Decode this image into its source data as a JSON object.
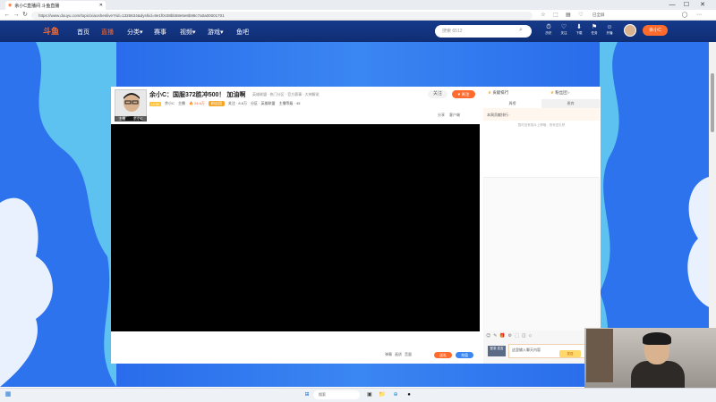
{
  "browser": {
    "tab_title": "余小C直播间 斗鱼直播",
    "url": "https://www.douyu.com/topic/xiaoshenlive?rid=1326634&dyshid=8e1f0c08bb58e5e8b98c7a0a00001701",
    "buttons": {
      "back": "←",
      "forward": "→",
      "refresh": "↻"
    },
    "window": {
      "minimize": "—",
      "maximize": "☐",
      "close": "✕"
    },
    "toolbar_icons": [
      "star-icon",
      "extensions-icon",
      "profile-icon",
      "menu-icon"
    ],
    "right_text": "已全屏"
  },
  "header": {
    "logo": "斗鱼",
    "nav": [
      "首页",
      "直播",
      "分类▾",
      "赛事",
      "视频▾",
      "游戏▾",
      "鱼吧"
    ],
    "active_nav": "直播",
    "search_placeholder": "搜索 6512",
    "icons": [
      {
        "glyph": "⏱",
        "label": "历史"
      },
      {
        "glyph": "♡",
        "label": "关注"
      },
      {
        "glyph": "⬇",
        "label": "下载"
      },
      {
        "glyph": "⚑",
        "label": "任务"
      },
      {
        "glyph": "☺",
        "label": "开播"
      }
    ],
    "user": "余小C"
  },
  "room": {
    "streamer": "余小C",
    "title": "余小C：国服372胜冲500！ 加油啊",
    "category": "英雄联盟 · 热门分区 · 官方赛事 · 大神解说",
    "avatar_labels": [
      "主播",
      "余小C"
    ],
    "level_chip": "LV30",
    "meta": [
      "余小C",
      "主播",
      "🔥 24.6万",
      "粉丝团",
      "关注 · 8.6万",
      "分区 · 英雄联盟",
      "主播等级 · 45"
    ],
    "fans_badge": "粉丝团",
    "follow_count": "关注",
    "follow_btn": "♥ 关注",
    "tools": [
      "分享",
      "客户端"
    ],
    "bottom": {
      "controls": [
        "弹幕",
        "画质",
        "音量"
      ],
      "send_gift": "送礼",
      "recharge": "充值"
    }
  },
  "side": {
    "tab_rank": "贡献排行",
    "tab_top": "粉丝团 ›",
    "subtabs": [
      "周榜",
      "贵宾"
    ],
    "guard_row": "本周贡献排行  ·",
    "empty_tip": "暂时没有观众上榜哦，快来送礼吧",
    "chat_input_placeholder": "这里输入聊天内容",
    "chat_send": "发送",
    "login_tag": "登录\n发言",
    "chat_tools": [
      "😊",
      "✎",
      "🎁",
      "⚙",
      "⬚",
      "◫",
      "⬦"
    ]
  },
  "taskbar": {
    "search_label": "搜索",
    "apps": [
      "⊞",
      "🔍",
      "▣",
      "📁",
      "⊕",
      "●"
    ]
  }
}
